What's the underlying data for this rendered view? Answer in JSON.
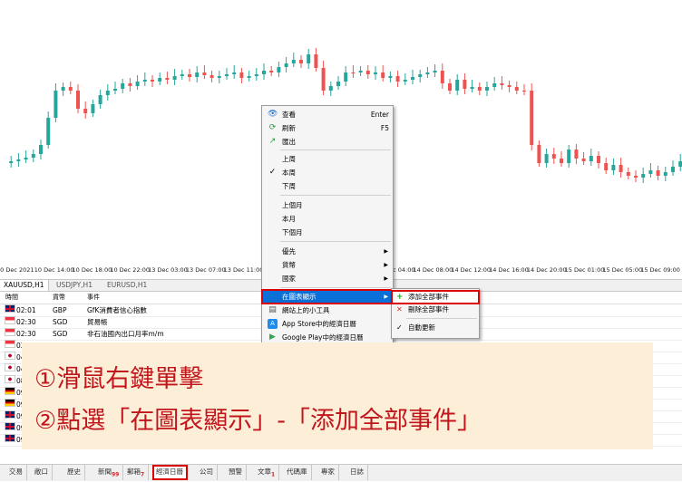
{
  "chart": {
    "tabs": [
      "XAUUSD,H1",
      "USDJPY,H1",
      "EURUSD,H1"
    ],
    "time_labels": [
      "10 Dec 2021",
      "10 Dec 14:00",
      "10 Dec 18:00",
      "10 Dec 22:00",
      "13 Dec 03:00",
      "13 Dec 07:00",
      "13 Dec 11:00",
      "13 Dec 15:00",
      "13 Dec 19:00",
      "13 Dec 23:00",
      "14 Dec 04:00",
      "14 Dec 08:00",
      "14 Dec 12:00",
      "14 Dec 16:00",
      "14 Dec 20:00",
      "15 Dec 01:00",
      "15 Dec 05:00",
      "15 Dec 09:00"
    ],
    "colors": {
      "bull": "#26a69a",
      "bear": "#ef5350"
    }
  },
  "context_menu": {
    "items": [
      {
        "label": "查看",
        "shortcut": "Enter",
        "icon": "eye-icon"
      },
      {
        "label": "刷新",
        "shortcut": "F5",
        "icon": "refresh-icon"
      },
      {
        "label": "匯出",
        "shortcut": "",
        "icon": "export-icon"
      },
      {
        "label": "上周",
        "shortcut": ""
      },
      {
        "label": "本周",
        "shortcut": "",
        "checked": true
      },
      {
        "label": "下周",
        "shortcut": ""
      },
      {
        "label": "上個月",
        "shortcut": ""
      },
      {
        "label": "本月",
        "shortcut": ""
      },
      {
        "label": "下個月",
        "shortcut": ""
      },
      {
        "label": "優先",
        "submenu": true
      },
      {
        "label": "貨幣",
        "submenu": true
      },
      {
        "label": "國家",
        "submenu": true
      },
      {
        "label": "在圖表顯示",
        "submenu": true,
        "selected": true
      },
      {
        "label": "網站上的小工具",
        "icon": "widget-icon"
      },
      {
        "label": "App Store中的經濟日曆",
        "icon": "app-store-icon"
      },
      {
        "label": "Google Play中的經濟日曆",
        "icon": "google-play-icon"
      }
    ],
    "check_mark": "✓",
    "submenu_arrow": "▶"
  },
  "submenu": {
    "add_all": "添加全部事件",
    "remove_all": "刪除全部事件",
    "auto_update": "自動更新",
    "plus": "+",
    "cross": "✕",
    "check": "✓"
  },
  "calendar": {
    "headers": {
      "time": "時間",
      "currency": "貨幣",
      "event": "事件"
    },
    "rows": [
      {
        "time": "02:01",
        "currency": "GBP",
        "event": "GfK消費者信心指數",
        "flag": "uk"
      },
      {
        "time": "02:30",
        "currency": "SGD",
        "event": "貿易帳",
        "flag": "sg"
      },
      {
        "time": "02:30",
        "currency": "SGD",
        "event": "非石油國內出口月率m/m",
        "flag": "sg"
      },
      {
        "time": "02:30",
        "currency": "SGD",
        "event": "",
        "flag": "sg"
      },
      {
        "time": "04",
        "currency": "",
        "event": "",
        "flag": "jp"
      },
      {
        "time": "04",
        "currency": "",
        "event": "",
        "flag": "jp"
      },
      {
        "time": "08",
        "currency": "",
        "event": "",
        "flag": "jp"
      },
      {
        "time": "09",
        "currency": "",
        "event": "",
        "flag": "de"
      },
      {
        "time": "09",
        "currency": "",
        "event": "",
        "flag": "de"
      },
      {
        "time": "09",
        "currency": "",
        "event": "",
        "flag": "uk"
      },
      {
        "time": "09",
        "currency": "",
        "event": "",
        "flag": "uk"
      },
      {
        "time": "09",
        "currency": "GBP",
        "event": "核心零售銷售指數月率m/m",
        "flag": "uk"
      }
    ]
  },
  "bottom_tabs": [
    {
      "label": "交易",
      "badge": ""
    },
    {
      "label": "敞口",
      "badge": ""
    },
    {
      "label": "歷史",
      "badge": ""
    },
    {
      "label": "新聞",
      "badge": "99"
    },
    {
      "label": "郵箱",
      "badge": "7"
    },
    {
      "label": "經濟日曆",
      "badge": "",
      "highlight": true
    },
    {
      "label": "公司",
      "badge": ""
    },
    {
      "label": "預警",
      "badge": ""
    },
    {
      "label": "文章",
      "badge": "1"
    },
    {
      "label": "代碼庫",
      "badge": ""
    },
    {
      "label": "專家",
      "badge": ""
    },
    {
      "label": "日誌",
      "badge": ""
    }
  ],
  "annotation": {
    "line1": "①滑鼠右鍵單擊",
    "line2": "②點選「在圖表顯示」-「添加全部事件」"
  }
}
